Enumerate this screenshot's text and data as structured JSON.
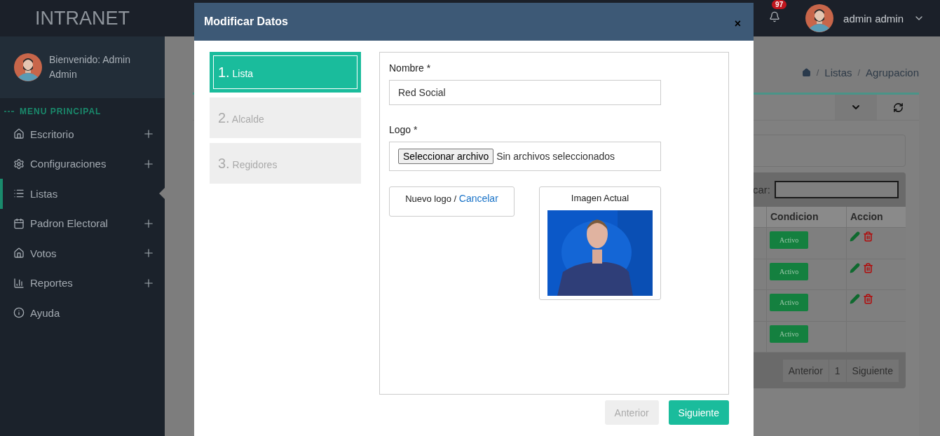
{
  "header": {
    "brand": "INTRANET",
    "notifications": "97",
    "user": "admin admin"
  },
  "sidebar": {
    "welcome": "Bienvenido: Admin Admin",
    "section": "MENU PRINCIPAL",
    "items": [
      {
        "label": "Escritorio",
        "expandable": true,
        "selected": false
      },
      {
        "label": "Configuraciones",
        "expandable": true,
        "selected": false
      },
      {
        "label": "Listas",
        "expandable": false,
        "selected": true
      },
      {
        "label": "Padron Electoral",
        "expandable": true,
        "selected": false
      },
      {
        "label": "Votos",
        "expandable": true,
        "selected": false
      },
      {
        "label": "Reportes",
        "expandable": true,
        "selected": false
      },
      {
        "label": "Ayuda",
        "expandable": false,
        "selected": false
      }
    ]
  },
  "breadcrumb": [
    {
      "kind": "separator",
      "text": "/"
    },
    {
      "kind": "link",
      "text": "Listas"
    },
    {
      "kind": "separator",
      "text": "/"
    },
    {
      "kind": "link",
      "text": "Agrupacion"
    }
  ],
  "table": {
    "search_label": "car:",
    "columns": [
      "Condicion",
      "Accion"
    ],
    "rows": [
      {
        "status": "Activo",
        "actions": true
      },
      {
        "status": "Activo",
        "actions": true
      },
      {
        "status": "Activo",
        "actions": true
      },
      {
        "status": "Activo",
        "actions": false
      }
    ],
    "pagination": [
      "Anterior",
      "1",
      "Siguiente"
    ]
  },
  "modal": {
    "title": "Modificar Datos",
    "close": "×",
    "steps": [
      {
        "number": "1.",
        "label": "Lista",
        "selected": true
      },
      {
        "number": "2.",
        "label": "Alcalde",
        "selected": false
      },
      {
        "number": "3.",
        "label": "Regidores",
        "selected": false
      }
    ],
    "name_label": "Nombre *",
    "name_value": "Red Social",
    "logo_label": "Logo *",
    "file_button": "Seleccionar archivo",
    "file_status": "Sin archivos seleccionados",
    "new_logo": "Nuevo logo / ",
    "cancel_link": "Cancelar",
    "current_image": "Imagen Actual",
    "buttons": [
      {
        "label": "Anterior",
        "disabled": true
      },
      {
        "label": "Siguiente",
        "disabled": false
      }
    ]
  }
}
